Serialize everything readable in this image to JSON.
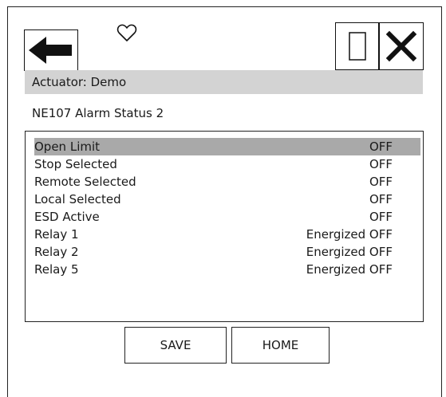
{
  "icons": {
    "back": "left-arrow-icon",
    "favorite": "heart-icon",
    "window": "square-icon",
    "close": "close-icon"
  },
  "header": {
    "actuator_label": "Actuator: Demo"
  },
  "page": {
    "title": "NE107 Alarm Status 2"
  },
  "status_list": [
    {
      "label": "Open Limit",
      "value": "OFF",
      "selected": true
    },
    {
      "label": "Stop Selected",
      "value": "OFF"
    },
    {
      "label": "Remote Selected",
      "value": "OFF"
    },
    {
      "label": "Local Selected",
      "value": "OFF"
    },
    {
      "label": "ESD Active",
      "value": "OFF"
    },
    {
      "label": "Relay 1",
      "value": "Energized OFF"
    },
    {
      "label": "Relay 2",
      "value": "Energized OFF"
    },
    {
      "label": "Relay 5",
      "value": "Energized OFF"
    }
  ],
  "footer": {
    "save_label": "SAVE",
    "home_label": "HOME"
  },
  "colors": {
    "header_bg": "#d3d3d3",
    "selected_row_bg": "#a9a9a9"
  }
}
